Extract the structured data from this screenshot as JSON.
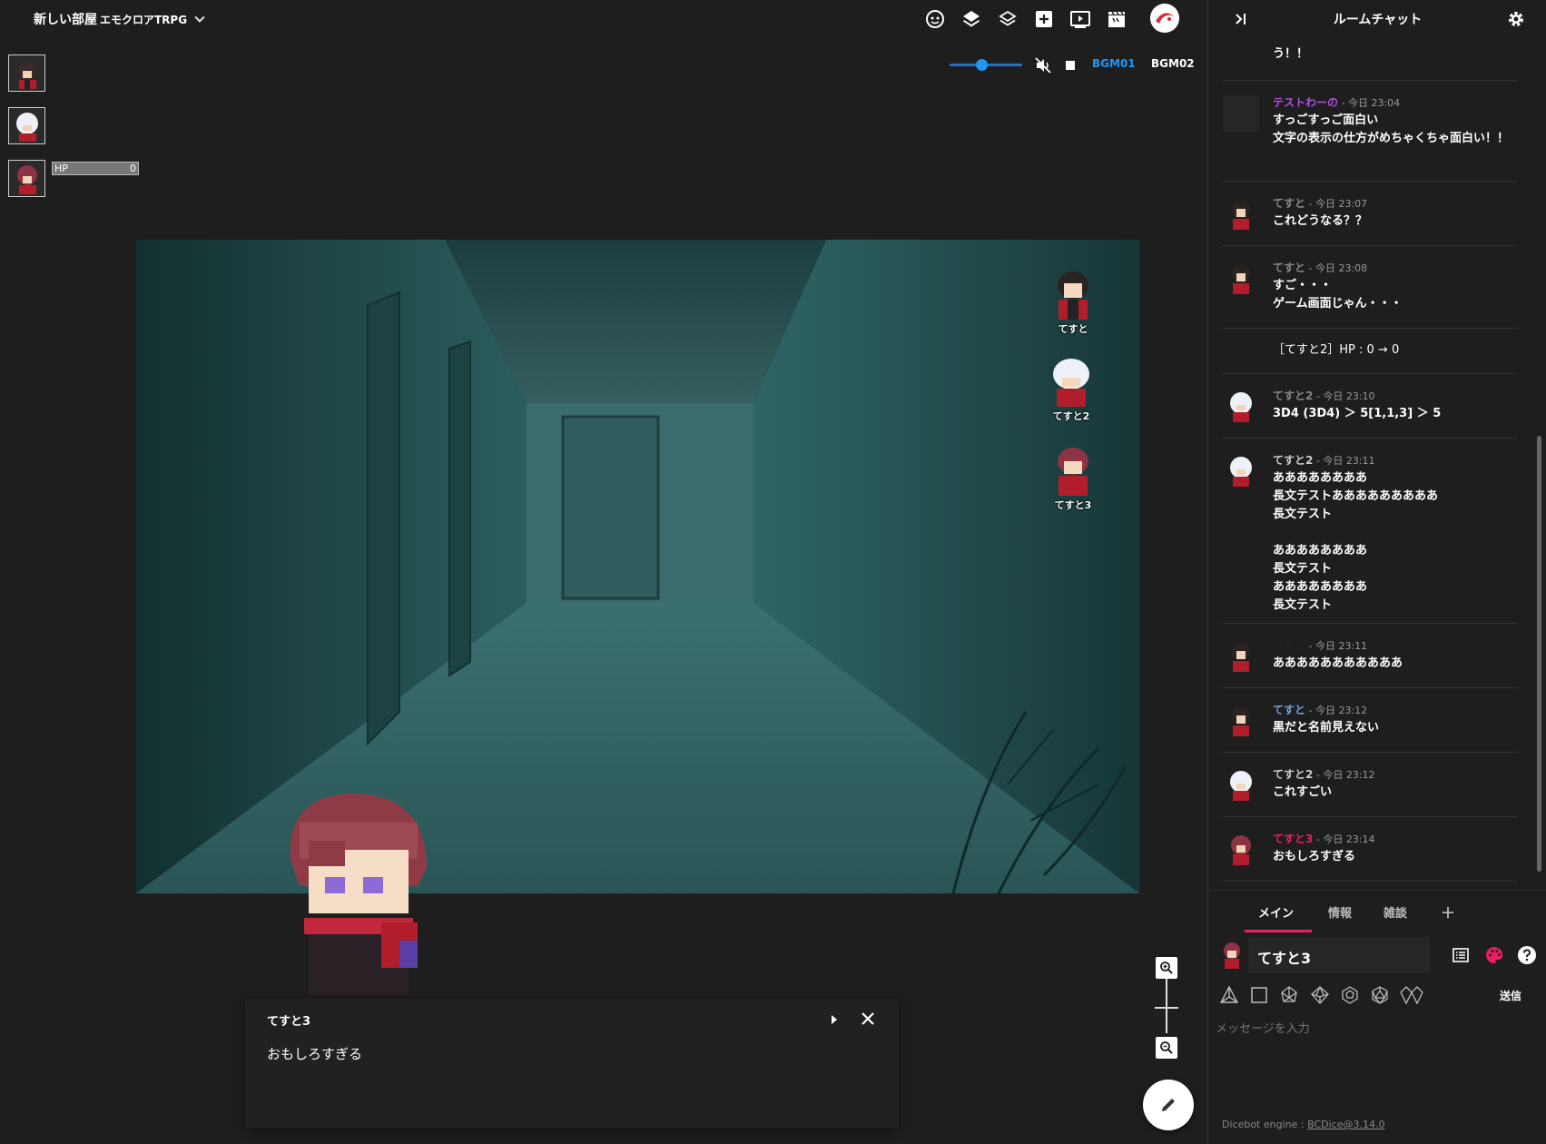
{
  "room": {
    "title": "新しい部屋",
    "system": "エモクロアTRPG"
  },
  "audio": {
    "bgm1": "BGM01",
    "bgm2": "BGM02",
    "volume": 0.45
  },
  "party": {
    "hp_label": "HP",
    "hp_value": "0"
  },
  "tokens": [
    {
      "name": "てすと"
    },
    {
      "name": "てすと2"
    },
    {
      "name": "てすと3"
    }
  ],
  "message_window": {
    "speaker": "てすと3",
    "text": "おもしろすぎる"
  },
  "panel": {
    "title": "ルームチャット"
  },
  "chat": [
    {
      "name": "",
      "time": "",
      "body": "う！！",
      "name_color": "#ffffff"
    },
    {
      "name": "テストわーの",
      "time": " - 今日 23:04",
      "body": "すっごすっご面白い\n文字の表示の仕方がめちゃくちゃ面白い！！",
      "name_color": "#b04fe0"
    },
    {
      "name": "てすと",
      "time": " - 今日 23:07",
      "body": "これどうなる？？",
      "name_color": "#888888"
    },
    {
      "name": "てすと",
      "time": " - 今日 23:08",
      "body": "すご・・・\nゲーム画面じゃん・・・",
      "name_color": "#888888"
    },
    {
      "name": "",
      "time": "",
      "body": "［てすと2］HP : 0 → 0",
      "name_color": "#ffffff"
    },
    {
      "name": "てすと2",
      "time": " - 今日 23:10",
      "body": "3D4 (3D4) ＞ 5[1,1,3] ＞ 5",
      "name_color": "#888888"
    },
    {
      "name": "てすと2",
      "time": " - 今日 23:11",
      "body": "ああああああああ\n長文テストあああああああああ\n長文テスト\n\nああああああああ\n長文テスト\nああああああああ\n長文テスト",
      "name_color": "#cccccc"
    },
    {
      "name": "てすと",
      "time": " - 今日 23:11",
      "body": "あああああああああああ",
      "name_color": "#222222"
    },
    {
      "name": "てすと",
      "time": " - 今日 23:12",
      "body": "黒だと名前見えない",
      "name_color": "#6fa6d6"
    },
    {
      "name": "てすと2",
      "time": " - 今日 23:12",
      "body": "これすごい",
      "name_color": "#cccccc"
    },
    {
      "name": "てすと3",
      "time": " - 今日 23:14",
      "body": "おもしろすぎる",
      "name_color": "#e91e63"
    }
  ],
  "tabs": [
    {
      "label": "メイン"
    },
    {
      "label": "情報"
    },
    {
      "label": "雑談"
    },
    {
      "label": "＋"
    }
  ],
  "sender": {
    "name": "てすと3"
  },
  "send_label": "送信",
  "input": {
    "placeholder": "メッセージを入力"
  },
  "footer": {
    "prefix": "Dicebot engine : ",
    "link": "BCDice@3.14.0"
  },
  "colors": {
    "accent": "#e91e63",
    "bgm_active": "#2196f3"
  },
  "icons": [
    "face-icon",
    "layers-icon",
    "layers-outline-icon",
    "add-box-icon",
    "play-box-icon",
    "clapper-icon",
    "collapse-panel-icon",
    "gear-icon",
    "zoom-in-icon",
    "zoom-out-icon",
    "pencil-icon",
    "list-icon",
    "palette-icon",
    "help-icon",
    "close-icon",
    "mute-icon",
    "stop-icon"
  ]
}
